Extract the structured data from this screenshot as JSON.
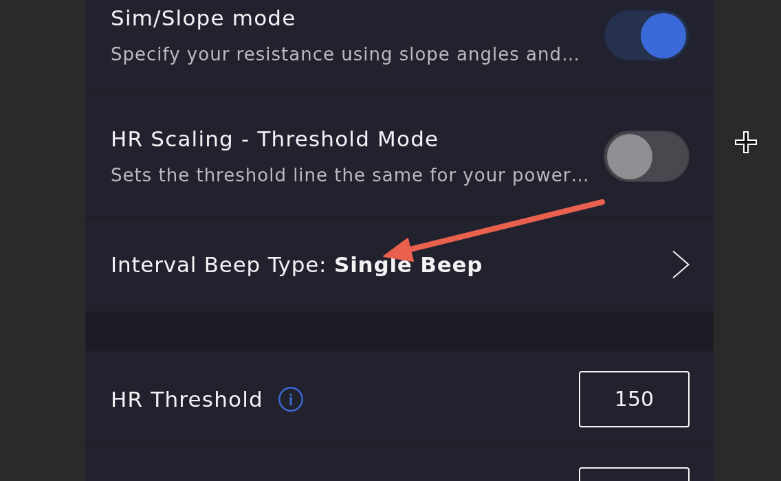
{
  "settings": {
    "sections": [
      {
        "rows": [
          {
            "kind": "toggle",
            "title": "Sim/Slope mode",
            "subtitle": "Specify your resistance using slope angles and…",
            "on": true
          },
          {
            "kind": "toggle",
            "title": "HR Scaling - Threshold Mode",
            "subtitle": "Sets the threshold line the same for your power…",
            "on": false
          },
          {
            "kind": "link",
            "label": "Interval Beep Type: **Single Beep**"
          }
        ]
      },
      {
        "rows": [
          {
            "kind": "number",
            "label": "HR Threshold",
            "info": true,
            "value": "150"
          },
          {
            "kind": "number"
          }
        ]
      }
    ]
  }
}
